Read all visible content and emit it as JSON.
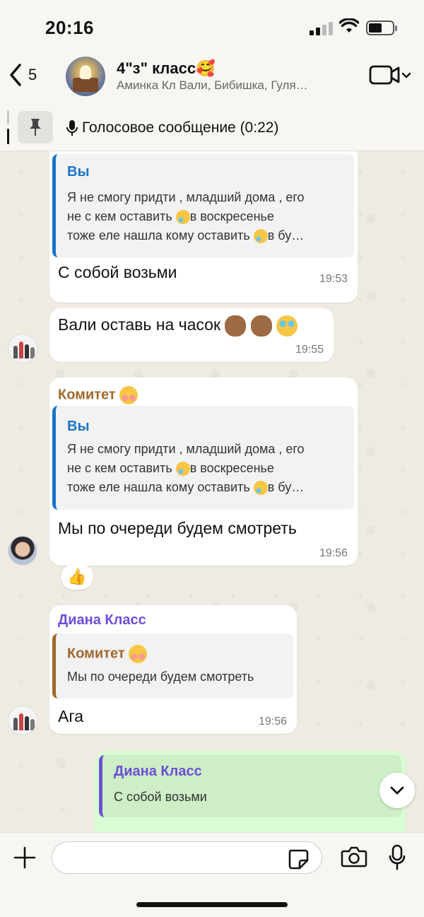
{
  "status_bar": {
    "time": "20:16"
  },
  "header": {
    "back_count": "5",
    "title": "4\"з\" класс🥰",
    "subtitle": "Аминка Кл  Вали, Бибишка, Гуля…",
    "icons": {
      "back": "chevron-left-icon",
      "video": "video-camera-icon"
    }
  },
  "pinned": {
    "text": "Голосовое сообщение (0:22)",
    "icon": "pin-icon"
  },
  "messages": [
    {
      "quote_name": "Вы",
      "quote_text": "Я не смогу придти , младший дома , его не с кем оставить 😢в воскресенье тоже еле нашла кому оставить 😢в бу…",
      "text": "С собой возьми",
      "time": "19:53"
    },
    {
      "text": "Вали оставь на часок 🙈🙈😂",
      "time": "19:55"
    },
    {
      "sender": "Комитет ☺️",
      "quote_name": "Вы",
      "quote_text": "Я не смогу придти , младший дома , его не с кем оставить 😢в воскресенье тоже еле нашла кому оставить 😢в бу…",
      "text": "Мы по очереди будем смотреть",
      "time": "19:56",
      "reaction": "👍"
    },
    {
      "sender": "Диана Класс",
      "quote_name": "Комитет ☺️",
      "quote_text": "Мы по очереди будем смотреть",
      "text": "Ага",
      "time": "19:56"
    },
    {
      "outgoing": true,
      "quote_name": "Диана Класс",
      "quote_text": "С собой возьми"
    }
  ],
  "composer": {
    "placeholder": "",
    "icons": {
      "plus": "plus-icon",
      "sticker": "sticker-icon",
      "camera": "camera-icon",
      "mic": "microphone-icon"
    }
  },
  "colors": {
    "accent_blue": "#1a73c9",
    "komitet_color": "#a0692c",
    "diana_color": "#6c4fd6",
    "outgoing_bubble": "#d9fdd3",
    "chat_background": "#efeae2"
  }
}
